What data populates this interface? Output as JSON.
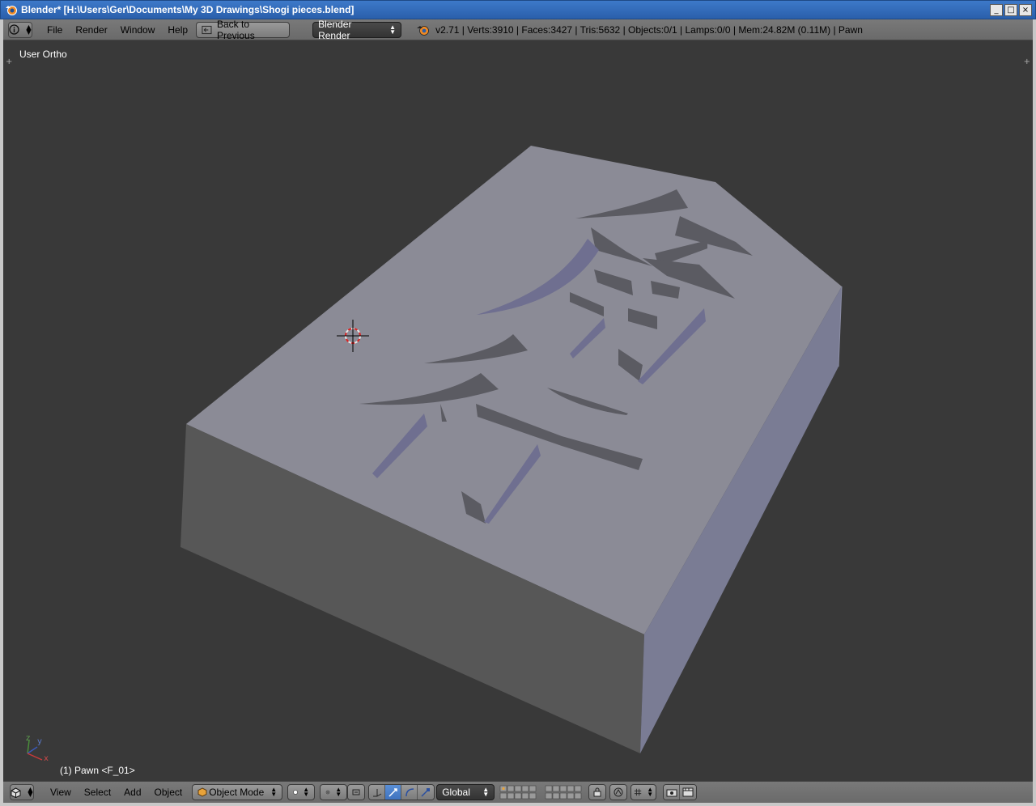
{
  "window": {
    "title": "Blender* [H:\\Users\\Ger\\Documents\\My 3D Drawings\\Shogi pieces.blend]",
    "buttons": {
      "minimize": "_",
      "maximize": "□",
      "close": "×"
    }
  },
  "info_header": {
    "menus": [
      "File",
      "Render",
      "Window",
      "Help"
    ],
    "back_button": "Back to Previous",
    "render_engine": "Blender Render",
    "stats": "v2.71 | Verts:3910 | Faces:3427 | Tris:5632 | Objects:0/1 | Lamps:0/0 | Mem:24.82M (0.11M) | Pawn"
  },
  "viewport": {
    "view_label": "User Ortho",
    "object_label": "(1) Pawn <F_01>",
    "axis_labels": {
      "x": "x",
      "y": "y",
      "z": "z"
    }
  },
  "view_header": {
    "menus": [
      "View",
      "Select",
      "Add",
      "Object"
    ],
    "mode": "Object Mode",
    "orientation": "Global"
  },
  "colors": {
    "viewport_bg": "#393939",
    "header_bg": "#727272",
    "accent": "#5680c2",
    "piece_top": "#8a8a96",
    "piece_front": "#575757",
    "piece_side": "#7a7c93"
  },
  "icons": [
    "blender-logo-icon",
    "info-icon",
    "back-icon",
    "render-icon",
    "view3d-icon",
    "object-mode-icon",
    "shading-icon",
    "pivot-icon",
    "manipulator-icon",
    "translate-icon",
    "rotate-icon",
    "scale-icon",
    "layers-icon",
    "lock-icon",
    "proportional-icon",
    "snap-icon",
    "render-still-icon",
    "render-anim-icon"
  ]
}
